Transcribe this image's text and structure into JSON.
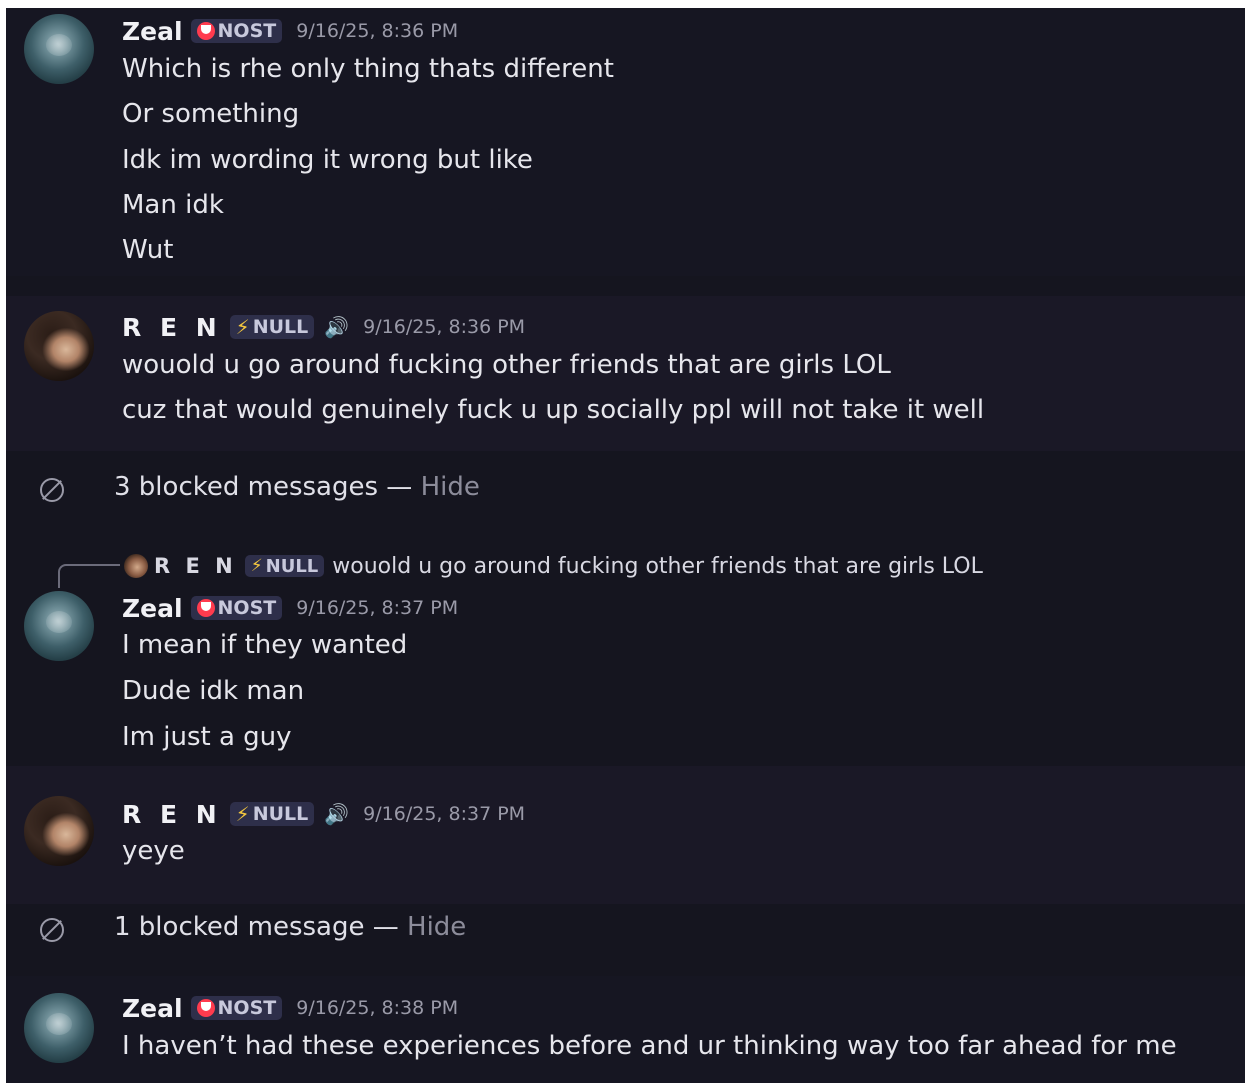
{
  "messages": [
    {
      "user": "Zeal",
      "tag": "NOST",
      "timestamp": "9/16/25, 8:36 PM",
      "lines": [
        "Which is rhe only thing thats different",
        "Or something",
        "Idk im wording it wrong but like",
        "Man idk",
        "Wut"
      ]
    },
    {
      "user": "R E N",
      "tag": "NULL",
      "timestamp": "9/16/25, 8:36 PM",
      "lines": [
        "wouold u go around fucking other friends that are girls LOL",
        "cuz that would genuinely fuck u up socially ppl will not take it well"
      ]
    },
    {
      "user": "Zeal",
      "tag": "NOST",
      "timestamp": "9/16/25, 8:37 PM",
      "reply": {
        "user": "R E N",
        "tag": "NULL",
        "text": "wouold u go around fucking other friends that are girls LOL"
      },
      "lines": [
        "I mean if they wanted",
        "Dude idk man",
        "Im just a guy"
      ]
    },
    {
      "user": "R E N",
      "tag": "NULL",
      "timestamp": "9/16/25, 8:37 PM",
      "lines": [
        "yeye"
      ]
    },
    {
      "user": "Zeal",
      "tag": "NOST",
      "timestamp": "9/16/25, 8:38 PM",
      "lines": [
        "I haven’t had these experiences before and ur thinking way too far ahead for me"
      ]
    }
  ],
  "blocked": [
    {
      "text": "3 blocked messages",
      "separator": " — ",
      "action": "Hide"
    },
    {
      "text": "1 blocked message",
      "separator": " — ",
      "action": "Hide"
    }
  ],
  "colors": {
    "background": "#15151f",
    "tag_bg": "#2e2f4a",
    "nost_icon": "#ff3b4e",
    "null_icon": "#f3c63f",
    "timestamp": "#9a9aa8"
  },
  "icons": {
    "nost": "heart-shield-icon",
    "null": "lightning-bolt-icon",
    "voice": "speaker-icon",
    "blocked": "blocked-icon"
  }
}
